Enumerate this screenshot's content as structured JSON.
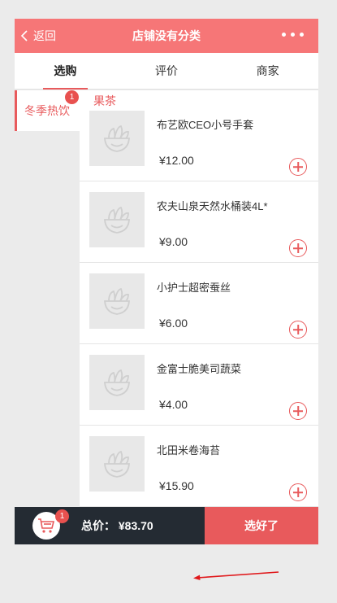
{
  "header": {
    "back_label": "返回",
    "title": "店铺没有分类"
  },
  "tabs": [
    {
      "label": "选购",
      "active": true
    },
    {
      "label": "评价",
      "active": false
    },
    {
      "label": "商家",
      "active": false
    }
  ],
  "sidebar": {
    "items": [
      {
        "label": "冬季热饮",
        "badge": "1"
      }
    ]
  },
  "section_title": "果茶",
  "products": [
    {
      "name": "布艺欧CEO小号手套",
      "price": "¥12.00"
    },
    {
      "name": "农夫山泉天然水桶装4L*",
      "price": "¥9.00"
    },
    {
      "name": "小护士超密蚕丝",
      "price": "¥6.00"
    },
    {
      "name": "金富士脆美司蔬菜",
      "price": "¥4.00"
    },
    {
      "name": "北田米卷海苔",
      "price": "¥15.90"
    }
  ],
  "cart": {
    "badge": "1",
    "total_label": "总价：",
    "total_value": "¥83.70",
    "checkout_label": "选好了"
  },
  "colors": {
    "accent": "#f67677",
    "accent_dark": "#e85a5c",
    "cartbar": "#242b33"
  }
}
